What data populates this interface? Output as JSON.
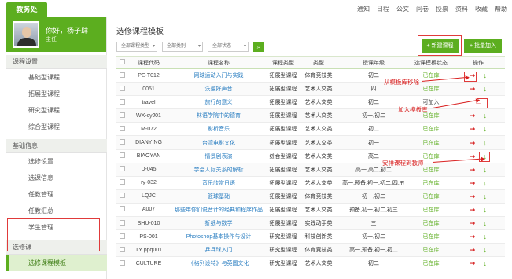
{
  "brand": "教务处",
  "topnav": [
    "通知",
    "日程",
    "公文",
    "问卷",
    "投票",
    "资料",
    "收藏",
    "帮助"
  ],
  "user": {
    "greeting": "你好，杨子肆",
    "role": "主任"
  },
  "sidebar": {
    "group1": {
      "title": "课程设置",
      "items": [
        "基础型课程",
        "拓展型课程",
        "研究型课程",
        "综合型课程"
      ]
    },
    "group2": {
      "title": "基础信息",
      "items": [
        "选修设置",
        "选课信息",
        "任教管理",
        "任教汇总",
        "学生管理"
      ]
    },
    "group3": {
      "title": "选修课",
      "items": [
        "选修课程模板"
      ],
      "active": "选修课程模板"
    }
  },
  "main": {
    "title": "选修课程模板",
    "filters": [
      "-全部课程类型-",
      "-全部类别-",
      "-全部状态-"
    ],
    "search_icon": "search-icon",
    "btn_new": "+ 新建课程",
    "btn_batch": "+ 批量加入"
  },
  "table": {
    "headers": [
      "课程代码",
      "课程名称",
      "课程类型",
      "类型",
      "授课年级",
      "选课模板状态",
      "操作"
    ],
    "rows": [
      {
        "code": "PE-T012",
        "name": "网球运动入门与实践",
        "ctype": "拓展型课程",
        "cat": "体育竞技类",
        "grade": "初二",
        "status": "已在库",
        "op": "move"
      },
      {
        "code": "0051",
        "name": "沃蕾好声音",
        "ctype": "拓展型课程",
        "cat": "艺术人文类",
        "grade": "四",
        "status": "已在库",
        "op": "down"
      },
      {
        "code": "travel",
        "name": "旅行的意义",
        "ctype": "拓展型课程",
        "cat": "艺术人文类",
        "grade": "初二",
        "status": "可加入",
        "op": "add"
      },
      {
        "code": "WX-cyJ01",
        "name": "林语学院中的德育",
        "ctype": "拓展型课程",
        "cat": "艺术人文类",
        "grade": "初一,初二",
        "status": "已在库",
        "op": "move"
      },
      {
        "code": "M-072",
        "name": "影析音乐",
        "ctype": "拓展型课程",
        "cat": "艺术人文类",
        "grade": "初二",
        "status": "已在库",
        "op": "move"
      },
      {
        "code": "DIANYING",
        "name": "台湾电影文化",
        "ctype": "拓展型课程",
        "cat": "艺术人文类",
        "grade": "初一",
        "status": "已在库",
        "op": "move"
      },
      {
        "code": "BIAOYAN",
        "name": "情景剧表演",
        "ctype": "综合型课程",
        "cat": "艺术人文类",
        "grade": "高二",
        "status": "已在库",
        "op": "move"
      },
      {
        "code": "D-045",
        "name": "学会人际关系的解析",
        "ctype": "拓展型课程",
        "cat": "艺术人文类",
        "grade": "高一,高二,初二",
        "status": "已在库",
        "op": "move"
      },
      {
        "code": "ry-032",
        "name": "音乐欣赏日语",
        "ctype": "拓展型课程",
        "cat": "艺术人文类",
        "grade": "高一,预备,初一,初二,四,五",
        "status": "已在库",
        "op": "move"
      },
      {
        "code": "LQJC",
        "name": "篮球基础",
        "ctype": "拓展型课程",
        "cat": "体育竞技类",
        "grade": "初一,初二",
        "status": "已在库",
        "op": "move"
      },
      {
        "code": "A007",
        "name": "那些年你们说音计的经典和程序作品",
        "ctype": "拓展型课程",
        "cat": "艺术人文类",
        "grade": "预备,初一,初二,初三",
        "status": "已在库",
        "op": "move"
      },
      {
        "code": "SHU-010",
        "name": "折纸与数学",
        "ctype": "拓展型课程",
        "cat": "实践动手类",
        "grade": "三",
        "status": "已在库",
        "op": "move"
      },
      {
        "code": "PS-001",
        "name": "Photoshop基本操作与设计",
        "ctype": "研究型课程",
        "cat": "科技创新类",
        "grade": "初一,初二",
        "status": "已在库",
        "op": "move"
      },
      {
        "code": "TY ppq001",
        "name": "乒乓球入门",
        "ctype": "研究型课程",
        "cat": "体育竞技类",
        "grade": "高一,预备,初一,初二",
        "status": "已在库",
        "op": "move"
      },
      {
        "code": "CULTURE",
        "name": "《格列设特》与英国文化",
        "ctype": "研究型课程",
        "cat": "艺术人文类",
        "grade": "初二",
        "status": "已在库",
        "op": "move"
      }
    ]
  },
  "annotations": {
    "remove": "从模板库移除",
    "add": "加入模板库",
    "assign": "安排课程到教师"
  },
  "colors": {
    "accent": "#5cae1f",
    "annotation": "#d92020",
    "link": "#2a7ec1"
  }
}
